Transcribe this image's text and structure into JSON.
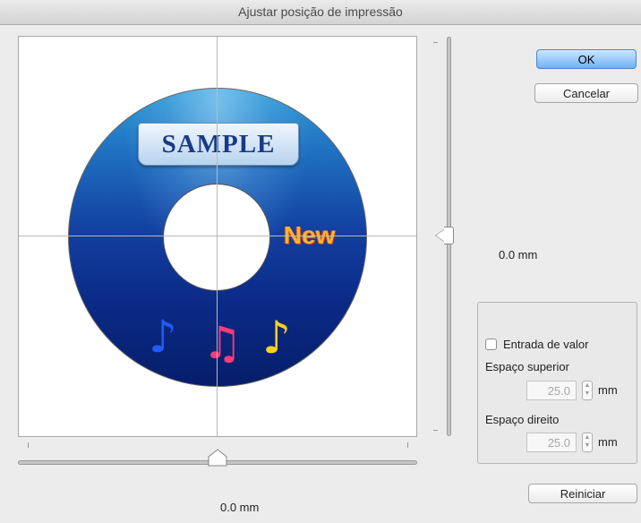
{
  "window": {
    "title": "Ajustar posição de impressão"
  },
  "preview": {
    "disc_text": "SAMPLE",
    "disc_new": "New",
    "notes": [
      "♪",
      "♫",
      "♪"
    ]
  },
  "vertical": {
    "value_text": "0.0 mm",
    "value": 0.0
  },
  "horizontal": {
    "value_text": "0.0 mm",
    "value": 0.0
  },
  "buttons": {
    "ok": "OK",
    "cancel": "Cancelar",
    "reset": "Reiniciar"
  },
  "value_entry": {
    "checkbox_label": "Entrada de valor",
    "checked": false,
    "top_label": "Espaço superior",
    "top_value": "25.0",
    "right_label": "Espaço direito",
    "right_value": "25.0",
    "unit": "mm"
  },
  "colors": {
    "ok_button": "#6fb1f5",
    "disc_dark": "#061e6a",
    "disc_light": "#2f9ad6"
  }
}
